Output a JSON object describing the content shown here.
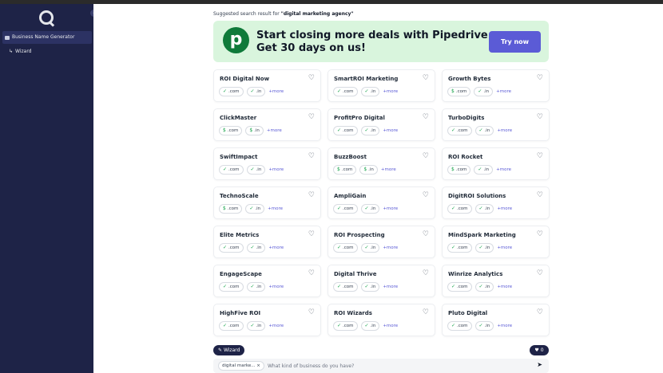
{
  "sidebar": {
    "items": [
      {
        "label": "Business Name Generator"
      },
      {
        "label": "Wizard",
        "prefix": "↳"
      }
    ]
  },
  "suggest": {
    "prefix": "Suggested search result for ",
    "query": "\"digital marketing agency\""
  },
  "banner": {
    "logo_letter": "p",
    "line1": "Start closing more deals with Pipedrive.",
    "line2": "Get 30 days on us!",
    "cta": "Try now"
  },
  "more_label": "+more",
  "results": [
    {
      "name": "ROI Digital Now",
      "com": "check",
      "in": "check"
    },
    {
      "name": "SmartROI Marketing",
      "com": "check",
      "in": "check"
    },
    {
      "name": "Growth Bytes",
      "com": "dollar",
      "in": "check"
    },
    {
      "name": "ClickMaster",
      "com": "dollar",
      "in": "dollar"
    },
    {
      "name": "ProfitPro Digital",
      "com": "check",
      "in": "check"
    },
    {
      "name": "TurboDigits",
      "com": "check",
      "in": "check"
    },
    {
      "name": "SwiftImpact",
      "com": "check",
      "in": "check"
    },
    {
      "name": "BuzzBoost",
      "com": "dollar",
      "in": "dollar"
    },
    {
      "name": "ROI Rocket",
      "com": "dollar",
      "in": "check"
    },
    {
      "name": "TechnoScale",
      "com": "dollar",
      "in": "check"
    },
    {
      "name": "AmpliGain",
      "com": "check",
      "in": "check"
    },
    {
      "name": "DigitROI Solutions",
      "com": "check",
      "in": "check"
    },
    {
      "name": "Elite Metrics",
      "com": "check",
      "in": "check"
    },
    {
      "name": "ROI Prospecting",
      "com": "check",
      "in": "check"
    },
    {
      "name": "MindSpark Marketing",
      "com": "check",
      "in": "check"
    },
    {
      "name": "EngageScape",
      "com": "check",
      "in": "check"
    },
    {
      "name": "Digital Thrive",
      "com": "check",
      "in": "check"
    },
    {
      "name": "Winrize Analytics",
      "com": "check",
      "in": "check"
    },
    {
      "name": "HighFive ROI",
      "com": "check",
      "in": "check"
    },
    {
      "name": "ROI Wizards",
      "com": "check",
      "in": "check"
    },
    {
      "name": "Pluto Digital",
      "com": "check",
      "in": "check"
    }
  ],
  "bottom": {
    "wizard_label": "Wizard",
    "fav_count": "0",
    "query_tag": "digital marke...",
    "query_placeholder": "What kind of business do you have?"
  },
  "colors": {
    "sidebar": "#1e2347",
    "accent": "#5b5bd6",
    "available": "#16a34a",
    "banner_bg": "#d9f5dd",
    "pipedrive_green": "#0f7a3a"
  }
}
